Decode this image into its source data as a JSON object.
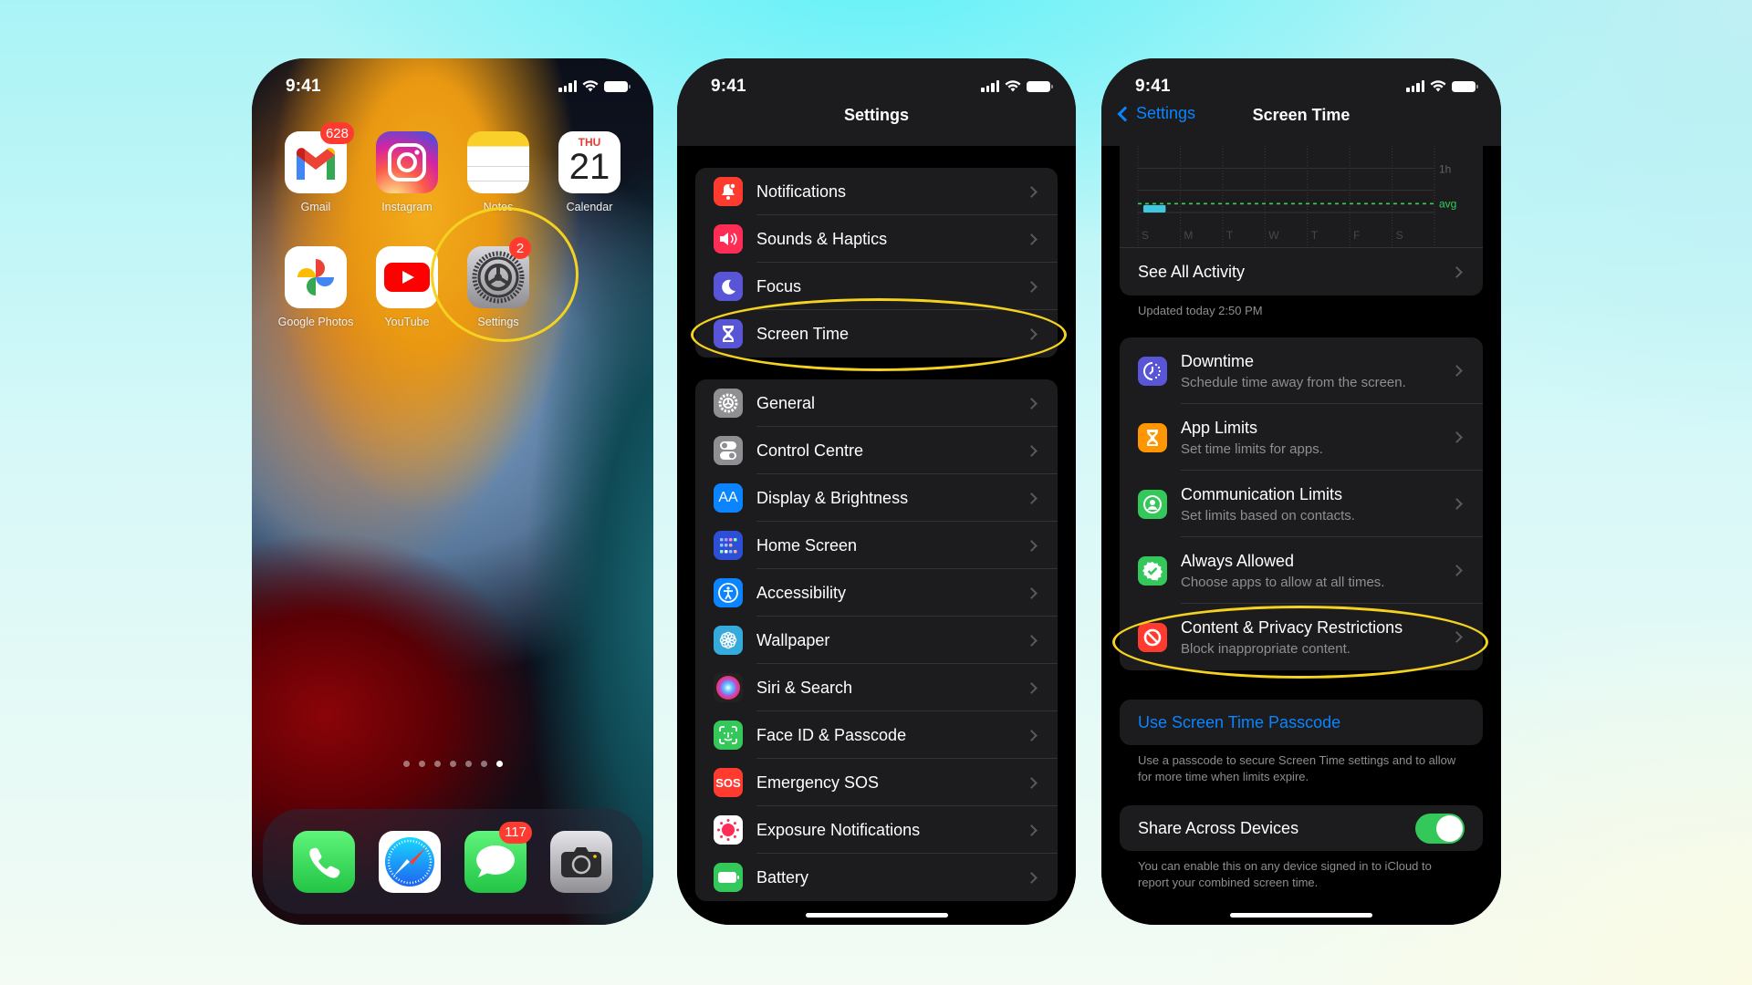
{
  "colors": {
    "accent_blue": "#0a84ff",
    "highlight_yellow": "#f4d21f",
    "badge_red": "#ff3b30",
    "toggle_green": "#34c759",
    "chart_bar": "#3fc8e0",
    "avg_green": "#30d158"
  },
  "status_bar": {
    "time": "9:41"
  },
  "home_screen": {
    "apps": [
      {
        "label": "Gmail",
        "icon": "gmail-icon",
        "badge": "628"
      },
      {
        "label": "Instagram",
        "icon": "instagram-icon",
        "badge": null
      },
      {
        "label": "Notes",
        "icon": "notes-icon",
        "badge": null
      },
      {
        "label": "Calendar",
        "icon": "calendar-icon",
        "badge": null,
        "day": "THU",
        "date": "21"
      },
      {
        "label": "Google Photos",
        "icon": "google-photos-icon",
        "badge": null
      },
      {
        "label": "YouTube",
        "icon": "youtube-icon",
        "badge": null
      },
      {
        "label": "Settings",
        "icon": "settings-gear-icon",
        "badge": "2",
        "highlighted": true
      }
    ],
    "page_dots": {
      "count": 7,
      "active_index": 6
    },
    "dock": [
      {
        "label": "Phone",
        "icon": "phone-icon",
        "badge": null
      },
      {
        "label": "Safari",
        "icon": "safari-compass-icon",
        "badge": null
      },
      {
        "label": "Messages",
        "icon": "messages-icon",
        "badge": "117"
      },
      {
        "label": "Camera",
        "icon": "camera-icon",
        "badge": null
      }
    ]
  },
  "settings_screen": {
    "title": "Settings",
    "groups": [
      [
        {
          "label": "Notifications",
          "icon": "bell-icon",
          "color": "#ff3b30"
        },
        {
          "label": "Sounds & Haptics",
          "icon": "speaker-icon",
          "color": "#ff2d55"
        },
        {
          "label": "Focus",
          "icon": "moon-icon",
          "color": "#5856d6"
        },
        {
          "label": "Screen Time",
          "icon": "hourglass-icon",
          "color": "#5856d6",
          "highlighted": true
        }
      ],
      [
        {
          "label": "General",
          "icon": "gear-icon",
          "color": "#8e8e93"
        },
        {
          "label": "Control Centre",
          "icon": "toggles-icon",
          "color": "#8e8e93"
        },
        {
          "label": "Display & Brightness",
          "icon": "text-size-icon",
          "color": "#0a84ff",
          "glyph": "AA"
        },
        {
          "label": "Home Screen",
          "icon": "home-grid-icon",
          "color": "#2c4fd6"
        },
        {
          "label": "Accessibility",
          "icon": "accessibility-icon",
          "color": "#0a84ff"
        },
        {
          "label": "Wallpaper",
          "icon": "flower-icon",
          "color": "#35aadc"
        },
        {
          "label": "Siri & Search",
          "icon": "siri-icon",
          "color": "#222"
        },
        {
          "label": "Face ID & Passcode",
          "icon": "face-id-icon",
          "color": "#34c759"
        },
        {
          "label": "Emergency SOS",
          "icon": "sos-icon",
          "color": "#ff3b30",
          "glyph": "SOS"
        },
        {
          "label": "Exposure Notifications",
          "icon": "exposure-icon",
          "color": "#ffffff"
        },
        {
          "label": "Battery",
          "icon": "battery-icon",
          "color": "#34c759"
        }
      ]
    ]
  },
  "screen_time": {
    "back_label": "Settings",
    "title": "Screen Time",
    "chart_data": {
      "type": "bar",
      "categories": [
        "S",
        "M",
        "T",
        "W",
        "T",
        "F",
        "S"
      ],
      "values_minutes": [
        10,
        0,
        0,
        0,
        0,
        0,
        0
      ],
      "y_labels": [
        "1h"
      ],
      "avg_label": "avg",
      "avg_minutes": 12,
      "ylim_minutes": [
        0,
        90
      ]
    },
    "see_all": "See All Activity",
    "updated": "Updated today 2:50 PM",
    "items": [
      {
        "title": "Downtime",
        "subtitle": "Schedule time away from the screen.",
        "icon": "downtime-icon",
        "color": "#5856d6"
      },
      {
        "title": "App Limits",
        "subtitle": "Set time limits for apps.",
        "icon": "hourglass-icon",
        "color": "#ff9500"
      },
      {
        "title": "Communication Limits",
        "subtitle": "Set limits based on contacts.",
        "icon": "contact-icon",
        "color": "#34c759"
      },
      {
        "title": "Always Allowed",
        "subtitle": "Choose apps to allow at all times.",
        "icon": "checkmark-badge-icon",
        "color": "#34c759"
      },
      {
        "title": "Content & Privacy Restrictions",
        "subtitle": "Block inappropriate content.",
        "icon": "no-entry-icon",
        "color": "#ff3b30",
        "highlighted": true
      }
    ],
    "passcode_link": "Use Screen Time Passcode",
    "passcode_note": "Use a passcode to secure Screen Time settings and to allow for more time when limits expire.",
    "share_label": "Share Across Devices",
    "share_enabled": true,
    "share_note": "You can enable this on any device signed in to iCloud to report your combined screen time."
  }
}
